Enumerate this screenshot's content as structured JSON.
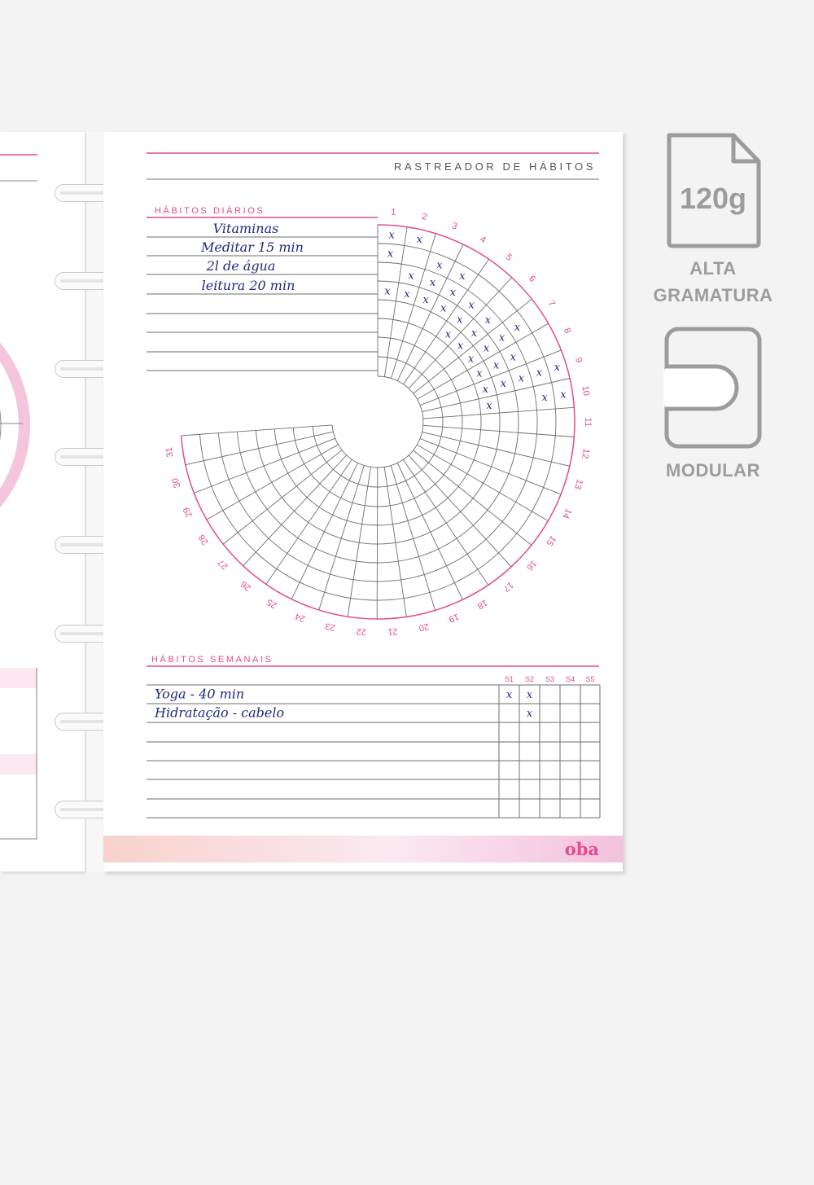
{
  "page": {
    "title": "RASTREADOR DE HÁBITOS",
    "daily_heading": "HÁBITOS DIÁRIOS",
    "weekly_heading": "HÁBITOS SEMANAIS",
    "brand": "oba"
  },
  "daily_habits": [
    "Vitaminas",
    "Meditar 15 min",
    "2l de água",
    "leitura 20 min",
    "",
    "",
    "",
    ""
  ],
  "day_labels": [
    "1",
    "2",
    "3",
    "4",
    "5",
    "6",
    "7",
    "8",
    "9",
    "10",
    "11",
    "12",
    "13",
    "14",
    "15",
    "16",
    "17",
    "18",
    "19",
    "20",
    "21",
    "22",
    "23",
    "24",
    "25",
    "26",
    "27",
    "28",
    "29",
    "30",
    "31"
  ],
  "daily_marks": [
    [
      1,
      2,
      4
    ],
    [
      1,
      3,
      4
    ],
    [
      2,
      3,
      4
    ],
    [
      2,
      3,
      4
    ],
    [
      3,
      4,
      5
    ],
    [
      3,
      4,
      5
    ],
    [
      2,
      3,
      4,
      5
    ],
    [
      3,
      4,
      5
    ],
    [
      1,
      2,
      3,
      4,
      5
    ],
    [
      1,
      2,
      5
    ]
  ],
  "mark_symbol": "x",
  "weekly_columns": [
    "S1",
    "S2",
    "S3",
    "S4",
    "S5"
  ],
  "weekly_habits": [
    {
      "name": "Yoga - 40 min",
      "marks": [
        true,
        true,
        false,
        false,
        false
      ]
    },
    {
      "name": "Hidratação - cabelo",
      "marks": [
        false,
        true,
        false,
        false,
        false
      ]
    },
    {
      "name": "",
      "marks": [
        false,
        false,
        false,
        false,
        false
      ]
    },
    {
      "name": "",
      "marks": [
        false,
        false,
        false,
        false,
        false
      ]
    },
    {
      "name": "",
      "marks": [
        false,
        false,
        false,
        false,
        false
      ]
    },
    {
      "name": "",
      "marks": [
        false,
        false,
        false,
        false,
        false
      ]
    },
    {
      "name": "",
      "marks": [
        false,
        false,
        false,
        false,
        false
      ]
    }
  ],
  "badges": [
    {
      "icon": "paper-weight-file-icon",
      "value": "120g",
      "label_lines": [
        "ALTA",
        "GRAMATURA"
      ]
    },
    {
      "icon": "modular-disc-icon",
      "label_lines": [
        "MODULAR"
      ]
    }
  ],
  "colors": {
    "accent_pink": "#e6498f",
    "ink_blue": "#1f2a80",
    "grid_gray": "#6e6e6e",
    "badge_gray": "#9c9c9c",
    "footer_gradient_start": "#f8d2cc",
    "footer_gradient_end": "#f3c1dd"
  }
}
